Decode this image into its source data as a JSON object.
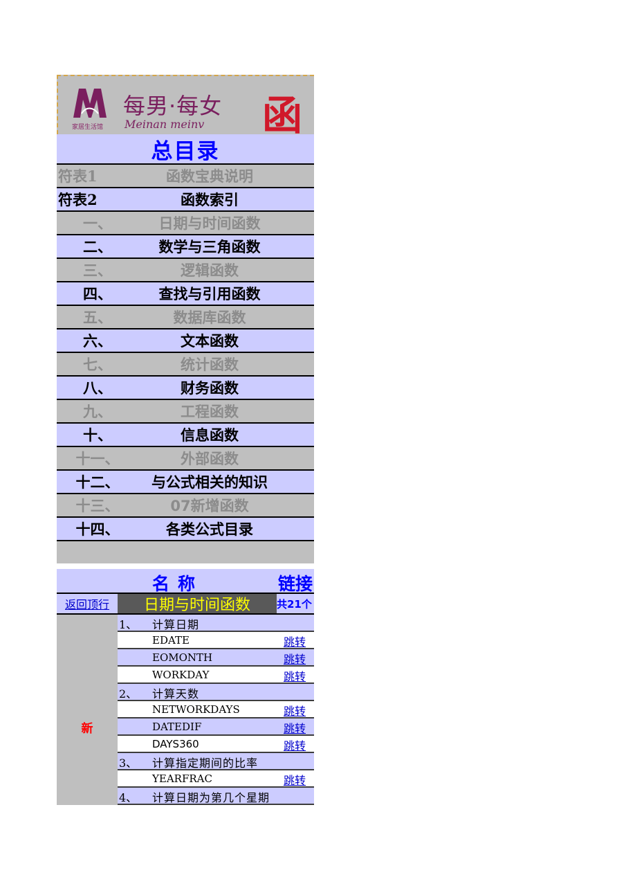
{
  "banner": {
    "brand_cn": "每男·每女",
    "brand_en": "Meinan meinv",
    "logo_sub": "家居生活馆",
    "red_text": "函"
  },
  "title": "总目录",
  "menu": [
    {
      "num": "符表1",
      "label": "函数宝典说明",
      "style": "gray"
    },
    {
      "num": "符表2",
      "label": "函数索引",
      "style": "lav"
    },
    {
      "num": "一、",
      "label": "日期与时间函数",
      "style": "gray"
    },
    {
      "num": "二、",
      "label": "数学与三角函数",
      "style": "lav"
    },
    {
      "num": "三、",
      "label": "逻辑函数",
      "style": "gray"
    },
    {
      "num": "四、",
      "label": "查找与引用函数",
      "style": "lav"
    },
    {
      "num": "五、",
      "label": "数据库函数",
      "style": "gray"
    },
    {
      "num": "六、",
      "label": "文本函数",
      "style": "lav"
    },
    {
      "num": "七、",
      "label": "统计函数",
      "style": "gray"
    },
    {
      "num": "八、",
      "label": "财务函数",
      "style": "lav"
    },
    {
      "num": "九、",
      "label": "工程函数",
      "style": "gray"
    },
    {
      "num": "十、",
      "label": "信息函数",
      "style": "lav"
    },
    {
      "num": "十一、",
      "label": "外部函数",
      "style": "gray"
    },
    {
      "num": "十二、",
      "label": "与公式相关的知识",
      "style": "lav"
    },
    {
      "num": "十三、",
      "label": "07新增函数",
      "style": "gray"
    },
    {
      "num": "十四、",
      "label": "各类公式目录",
      "style": "lav"
    }
  ],
  "columns": {
    "name": "名称",
    "link": "链接"
  },
  "section": {
    "back": "返回顶行",
    "title": "日期与时间函数",
    "count": "共21个"
  },
  "new_tag": "新",
  "jump_label": "跳转",
  "functions": [
    {
      "kind": "cat",
      "num": "1、",
      "text": "计算日期",
      "bg": "lav"
    },
    {
      "kind": "fn",
      "text": "EDATE",
      "bg": "white",
      "jump": true
    },
    {
      "kind": "fn",
      "text": "EOMONTH",
      "bg": "lav",
      "jump": true
    },
    {
      "kind": "fn",
      "text": "WORKDAY",
      "bg": "white",
      "jump": true
    },
    {
      "kind": "cat",
      "num": "2、",
      "text": "计算天数",
      "bg": "lav"
    },
    {
      "kind": "fn",
      "text": "NETWORKDAYS",
      "bg": "white",
      "jump": true
    },
    {
      "kind": "fn",
      "text": "DATEDIF",
      "bg": "lav",
      "jump": true
    },
    {
      "kind": "fn",
      "text": "DAYS360",
      "bg": "white",
      "jump": true,
      "sans": true
    },
    {
      "kind": "cat",
      "num": "3、",
      "text": "计算指定期间的比率",
      "bg": "lav"
    },
    {
      "kind": "fn",
      "text": "YEARFRAC",
      "bg": "white",
      "jump": true
    },
    {
      "kind": "cat",
      "num": "4、",
      "text": "计算日期为第几个星期",
      "bg": "lav"
    }
  ]
}
